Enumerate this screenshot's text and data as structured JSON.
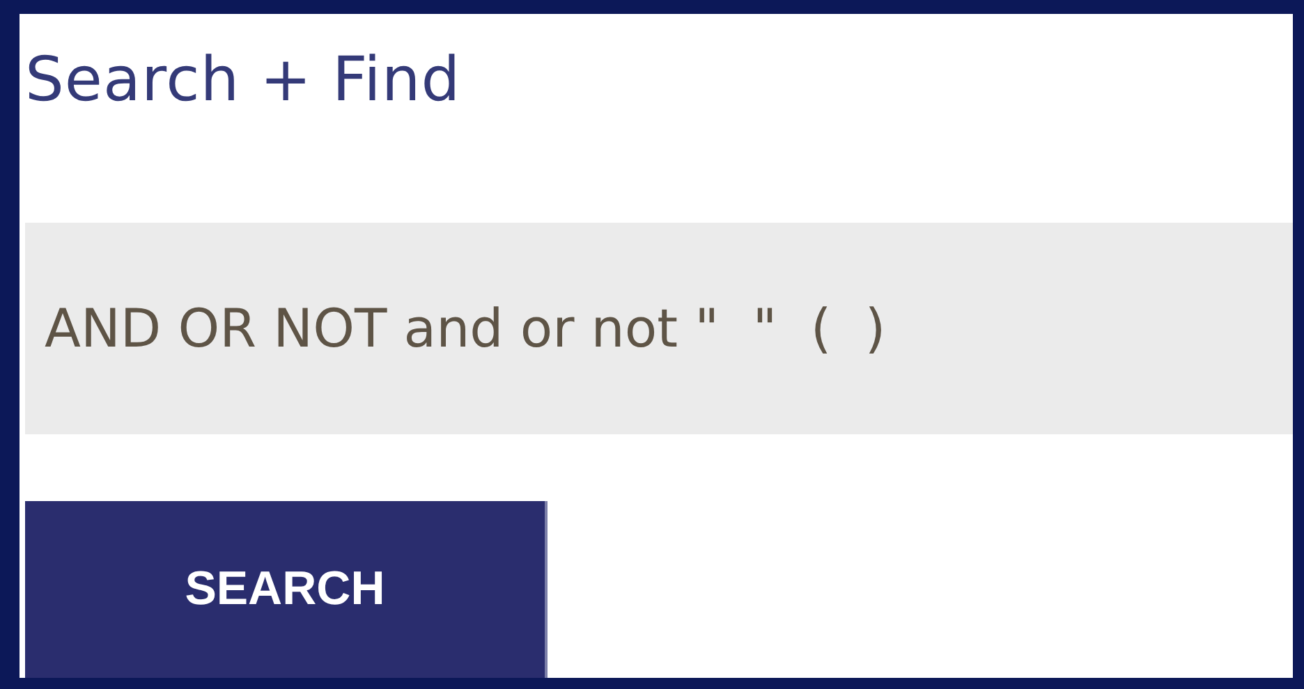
{
  "title": "Search + Find",
  "search": {
    "value": "AND OR NOT and or not \"  \"  (  )"
  },
  "button": {
    "label": "SEARCH"
  }
}
